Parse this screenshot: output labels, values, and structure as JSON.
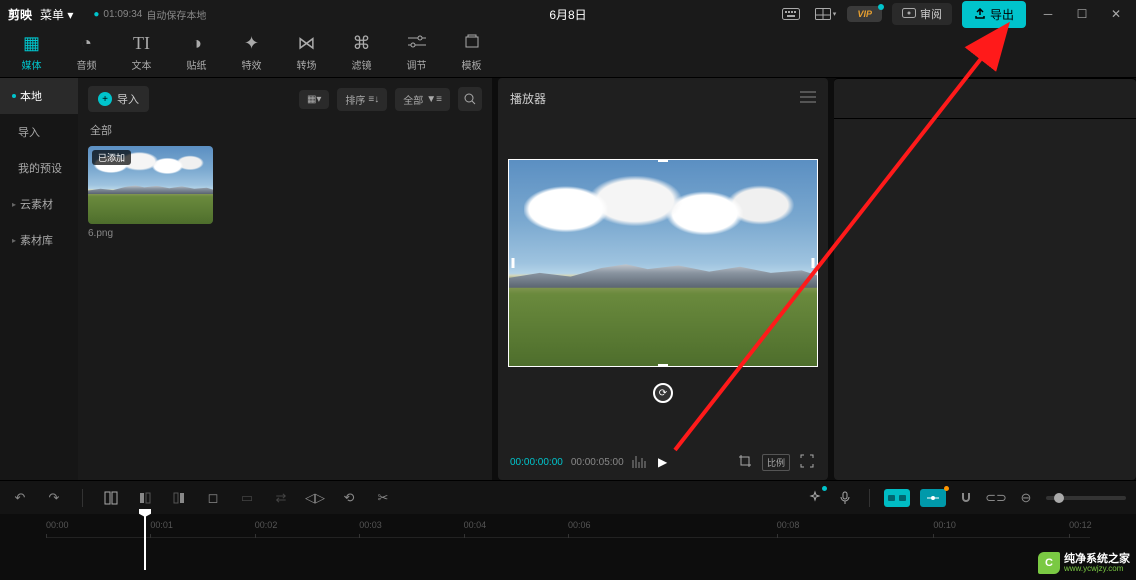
{
  "titlebar": {
    "logo": "剪映",
    "menu": "菜单 ▾",
    "autosave_time": "01:09:34",
    "autosave_text": "自动保存本地",
    "project": "6月8日",
    "vip": "VIP",
    "review": "审阅",
    "export": "导出"
  },
  "tool_tabs": [
    {
      "label": "媒体",
      "active": true
    },
    {
      "label": "音频"
    },
    {
      "label": "文本"
    },
    {
      "label": "贴纸"
    },
    {
      "label": "特效"
    },
    {
      "label": "转场"
    },
    {
      "label": "滤镜"
    },
    {
      "label": "调节"
    },
    {
      "label": "模板"
    }
  ],
  "sidebar": {
    "items": [
      {
        "label": "本地",
        "active": true,
        "caret": true,
        "dot": true
      },
      {
        "label": "导入",
        "sub": true
      },
      {
        "label": "我的预设",
        "sub": true
      },
      {
        "label": "云素材",
        "caret": true
      },
      {
        "label": "素材库",
        "caret": true
      }
    ]
  },
  "media": {
    "import": "导入",
    "sort": "排序",
    "all": "全部",
    "section": "全部",
    "thumb_tag": "已添加",
    "thumb_name": "6.png"
  },
  "player": {
    "title": "播放器",
    "time_cur": "00:00:00:00",
    "time_dur": "00:00:05:00",
    "ratio": "比例"
  },
  "timeline": {
    "ticks": [
      "00:00",
      "00:01",
      "00:02",
      "00:03",
      "00:04",
      "00:06",
      "00:08",
      "00:10",
      "00:12"
    ]
  },
  "watermark": {
    "line1": "纯净系统之家",
    "line2": "www.ycwjzy.com"
  }
}
